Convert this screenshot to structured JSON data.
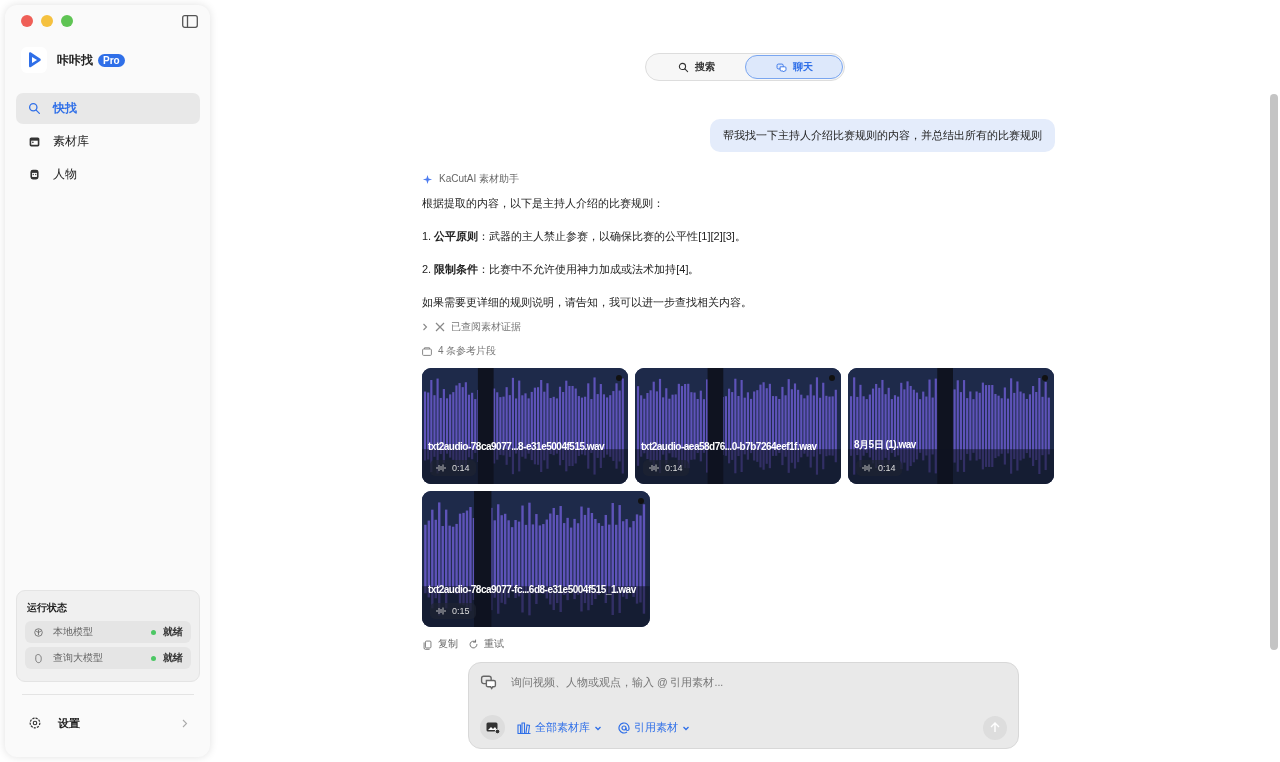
{
  "app": {
    "name": "咔咔找",
    "badge": "Pro"
  },
  "nav": [
    {
      "label": "快找",
      "selected": true
    },
    {
      "label": "素材库",
      "selected": false
    },
    {
      "label": "人物",
      "selected": false
    }
  ],
  "status_panel": {
    "title": "运行状态",
    "items": [
      {
        "label": "本地模型",
        "status": "就绪",
        "color": "#4cc764"
      },
      {
        "label": "查询大模型",
        "status": "就绪",
        "color": "#4cc764"
      }
    ]
  },
  "settings": {
    "label": "设置"
  },
  "mode_tabs": [
    {
      "label": "搜索",
      "selected": false
    },
    {
      "label": "聊天",
      "selected": true
    }
  ],
  "user_message": "帮我找一下主持人介绍比赛规则的内容，并总结出所有的比赛规则",
  "assistant": {
    "name": "KaCutAI 素材助手",
    "paragraphs": [
      "根据提取的内容，以下是主持人介绍的比赛规则：",
      "1. **公平原则**：武器的主人禁止参赛，以确保比赛的公平性[1][2][3]。",
      "2. **限制条件**：比赛中不允许使用神力加成或法术加持[4]。",
      "如果需要更详细的规则说明，请告知，我可以进一步查找相关内容。"
    ],
    "evidence": {
      "label": "已查阅素材证据",
      "expanded": false
    },
    "references_label": "4 条参考片段",
    "clips": [
      {
        "name": "txt2audio-78ca9077...8-e31e5004f515.wav",
        "duration": "0:14"
      },
      {
        "name": "txt2audio-aea58d76...0-b7b7264eef1f.wav",
        "duration": "0:14"
      },
      {
        "name": "8月5日 (1).wav",
        "duration": "0:14"
      },
      {
        "name": "txt2audio-78ca9077-fc...6d8-e31e5004f515_1.wav",
        "duration": "0:15"
      }
    ],
    "actions": [
      {
        "label": "复制"
      },
      {
        "label": "重试"
      }
    ]
  },
  "composer": {
    "placeholder": "询问视频、人物或观点，输入 @ 引用素材...",
    "scope": "全部素材库",
    "mention": "引用素材"
  }
}
